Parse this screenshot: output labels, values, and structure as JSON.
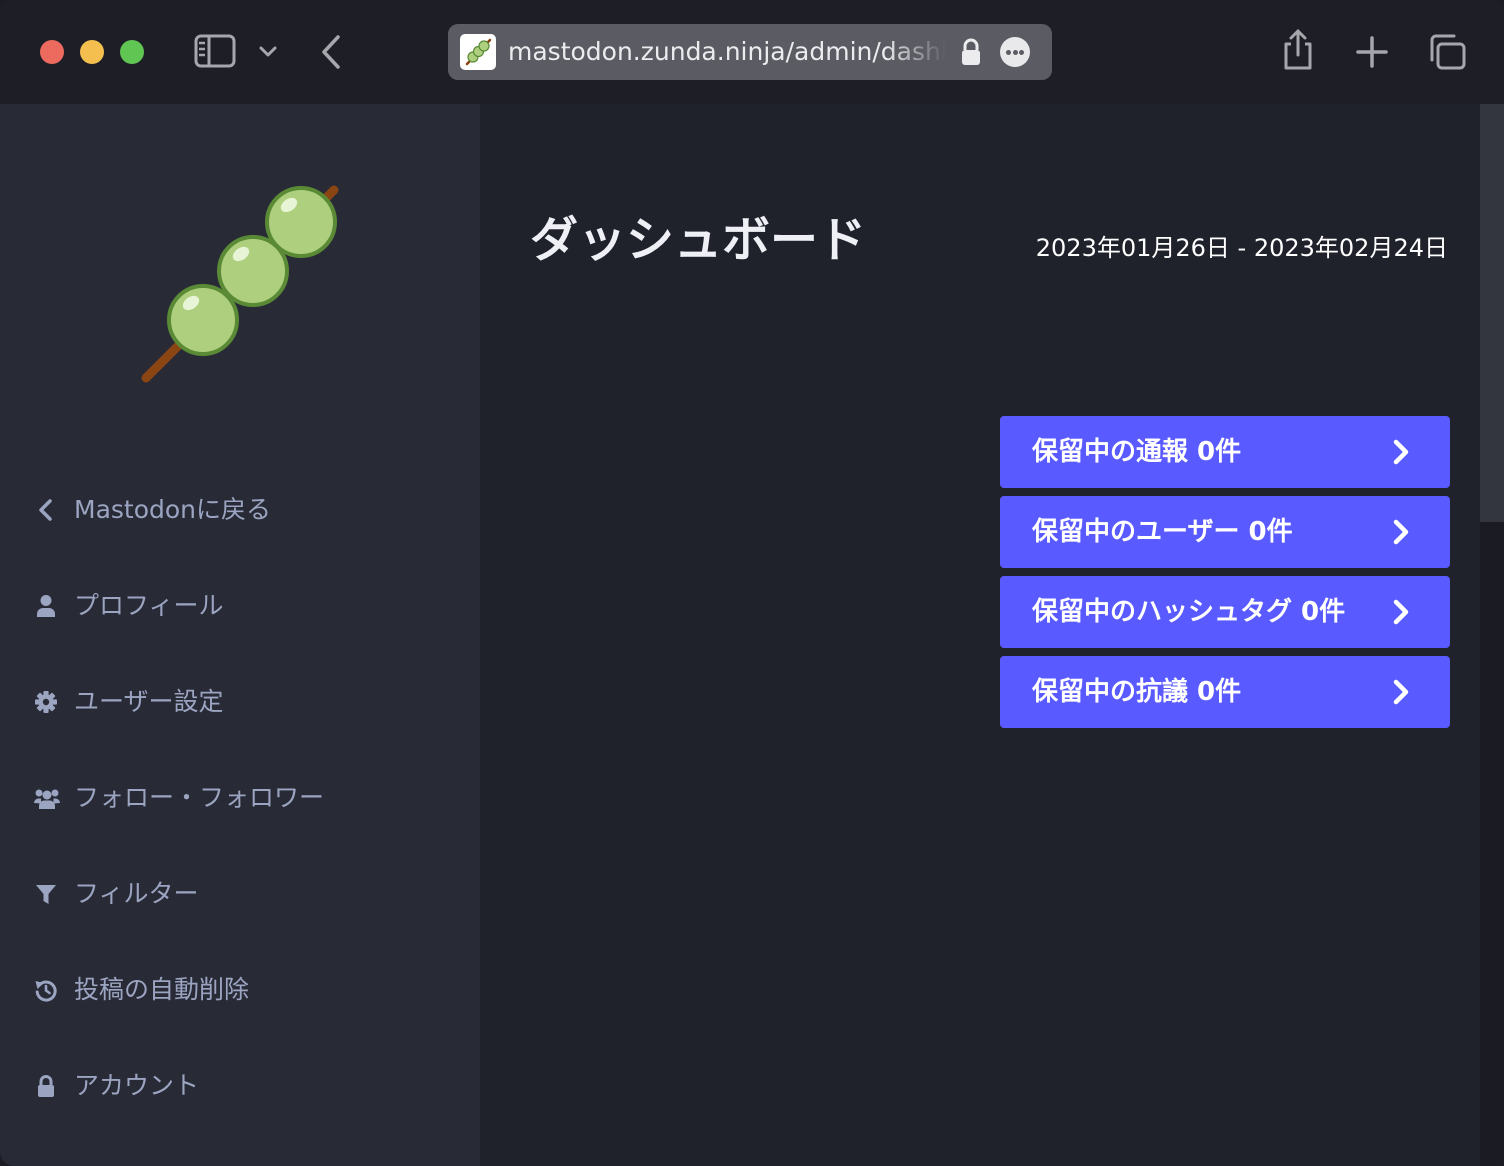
{
  "browser": {
    "url": "mastodon.zunda.ninja/admin/dashboard",
    "controls": [
      "close",
      "minimize",
      "maximize",
      "sidebar-toggle",
      "tab-overview-chevron",
      "back",
      "lock-icon",
      "page-menu",
      "share",
      "new-tab",
      "tab-overview"
    ]
  },
  "sidebar": {
    "items": [
      {
        "label": "Mastodonに戻る",
        "icon": "chevron-left-icon"
      },
      {
        "label": "プロフィール",
        "icon": "user-icon"
      },
      {
        "label": "ユーザー設定",
        "icon": "gear-icon"
      },
      {
        "label": "フォロー・フォロワー",
        "icon": "users-icon"
      },
      {
        "label": "フィルター",
        "icon": "filter-icon"
      },
      {
        "label": "投稿の自動削除",
        "icon": "history-icon"
      },
      {
        "label": "アカウント",
        "icon": "lock-icon"
      }
    ]
  },
  "main": {
    "title": "ダッシュボード",
    "date_range": "2023年01月26日 - 2023年02月24日",
    "actions": [
      {
        "label": "保留中の通報 0件"
      },
      {
        "label": "保留中のユーザー 0件"
      },
      {
        "label": "保留中のハッシュタグ 0件"
      },
      {
        "label": "保留中の抗議 0件"
      }
    ]
  },
  "colors": {
    "sidebar_bg": "#282a36",
    "main_bg": "#1f212b",
    "accent": "#595aff",
    "nav_text": "#9ba4c0",
    "dango_green": "#aed07e",
    "dango_outline": "#5a8a36",
    "skewer": "#8b4513"
  }
}
